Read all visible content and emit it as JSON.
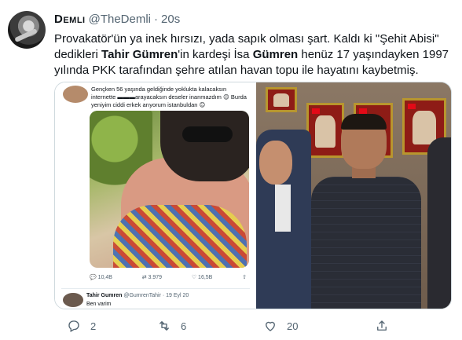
{
  "tweet": {
    "display_name": "Demli",
    "handle": "@TheDemli",
    "separator": "·",
    "time": "20s",
    "text_parts": [
      "Provakatör'ün ya inek hırsızı, yada sapık olması şart. Kaldı ki \"Şehit Abisi\" dedikleri ",
      "Tahir Gümren",
      "'in kardeşi İsa ",
      "Gümren",
      " henüz 17 yaşındayken 1997 yılında PKK tarafından şehre atılan havan topu ile hayatını kaybetmiş."
    ]
  },
  "embedded_tweet": {
    "text": "Gençken 56 yaşında geldiğinde yoklukta kalacaksın internette ▬▬▬arayacaksın deseler inanmazdım 😊 Burda yeniyim ciddi erkek arıyorum istanbuldan 😊",
    "actions": {
      "reply": "10,4B",
      "retweet": "3.979",
      "like": "16,5B"
    },
    "reply_name": "Tahir Gumren",
    "reply_meta": "@GumrenTahir · 19 Eyl 20",
    "reply_text": "Ben varim"
  },
  "actions": {
    "reply_count": "2",
    "retweet_count": "6",
    "like_count": "20"
  },
  "colors": {
    "text": "#0f1419",
    "muted": "#536471",
    "border": "#cfd9de"
  }
}
